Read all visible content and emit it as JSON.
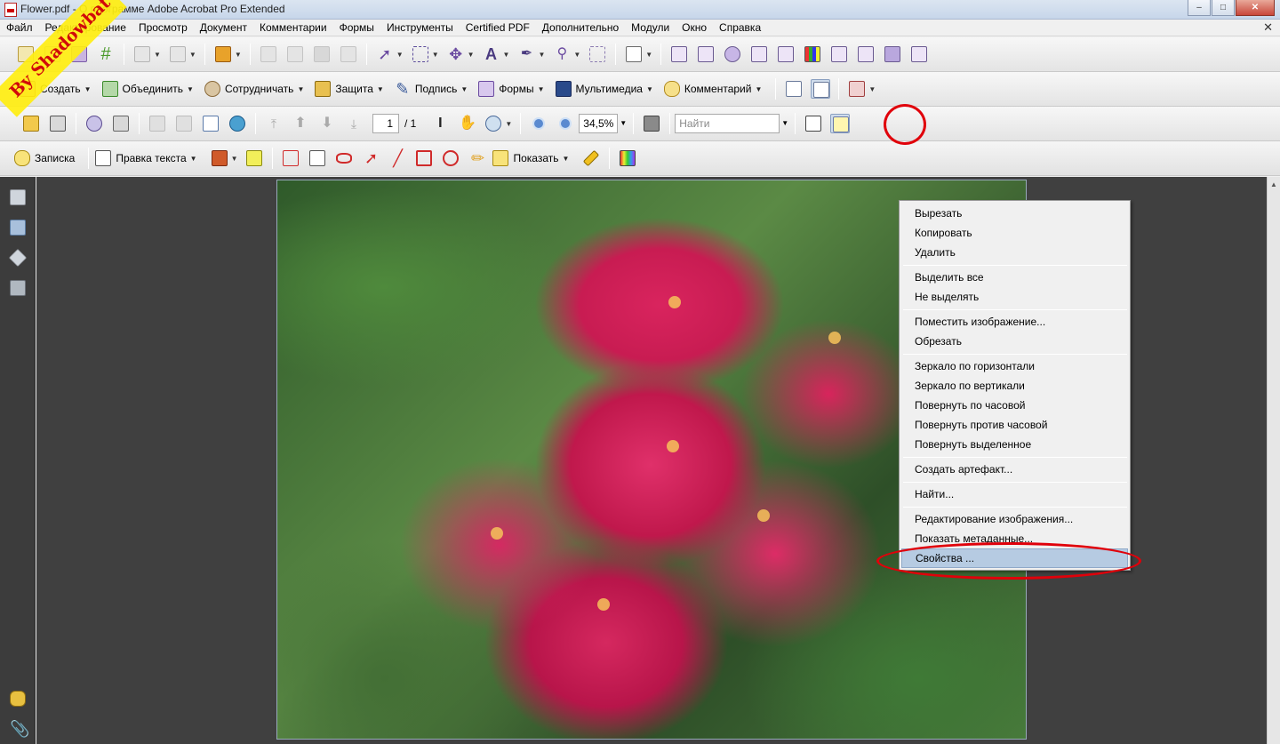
{
  "window": {
    "title": "Flower.pdf - О программе Adobe Acrobat Pro Extended",
    "buttons": {
      "minimize": "–",
      "maximize": "□",
      "close": "✕"
    }
  },
  "menu": [
    "Файл",
    "Редактирование",
    "Просмотр",
    "Документ",
    "Комментарии",
    "Формы",
    "Инструменты",
    "Certified PDF",
    "Дополнительно",
    "Модули",
    "Окно",
    "Справка"
  ],
  "menu_close": "✕",
  "tasks_toolbar": {
    "create": "Создать",
    "combine": "Объединить",
    "collaborate": "Сотрудничать",
    "secure": "Защита",
    "sign": "Подпись",
    "forms": "Формы",
    "multimedia": "Мультимедиа",
    "comment": "Комментарий"
  },
  "file_toolbar": {
    "page_current": "1",
    "page_total": "/ 1",
    "zoom": "34,5%",
    "find_placeholder": "Найти"
  },
  "comment_toolbar": {
    "note": "Записка",
    "text_edits": "Правка текста",
    "show": "Показать"
  },
  "context_menu": {
    "cut": "Вырезать",
    "copy": "Копировать",
    "delete": "Удалить",
    "select_all": "Выделить все",
    "deselect": "Не выделять",
    "place_image": "Поместить изображение...",
    "crop": "Обрезать",
    "flip_horizontal": "Зеркало по горизонтали",
    "flip_vertical": "Зеркало по вертикали",
    "rotate_cw": "Повернуть по часовой",
    "rotate_ccw": "Повернуть против часовой",
    "rotate_selection": "Повернуть выделенное",
    "create_artifact": "Создать артефакт...",
    "find": "Найти...",
    "edit_image": "Редактирование изображения...",
    "show_metadata": "Показать метаданные...",
    "properties": "Свойства ..."
  },
  "watermark": "By Shadowbat",
  "colors": {
    "accent_annotation": "#e0000a",
    "menu_highlight": "#b6cbe2",
    "document_background": "#404040"
  }
}
